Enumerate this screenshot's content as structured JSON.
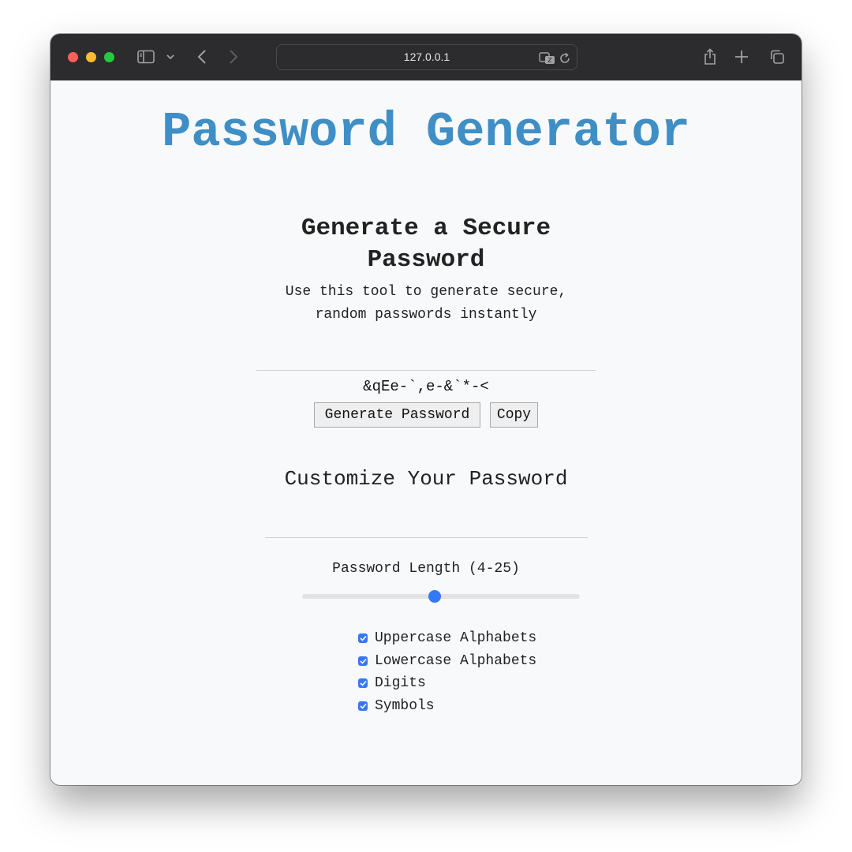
{
  "browser": {
    "url": "127.0.0.1",
    "icons": [
      "sidebar-icon",
      "chevron-down-icon",
      "back-icon",
      "forward-icon",
      "translate-icon",
      "reload-icon",
      "share-icon",
      "new-tab-icon",
      "tabs-overview-icon"
    ]
  },
  "page": {
    "title": "Password Generator",
    "subtitle": "Generate a Secure Password",
    "description": "Use this tool to generate secure, random passwords instantly",
    "password": "&qEe-`,e-&`*-<",
    "buttons": {
      "generate": "Generate Password",
      "copy": "Copy"
    },
    "customize_title": "Customize Your Password",
    "length_label": "Password Length (4-25)",
    "length_slider": {
      "min": 4,
      "max": 25,
      "value": 14
    },
    "options": [
      {
        "label": "Uppercase Alphabets",
        "checked": true
      },
      {
        "label": "Lowercase Alphabets",
        "checked": true
      },
      {
        "label": "Digits",
        "checked": true
      },
      {
        "label": "Symbols",
        "checked": true
      }
    ]
  },
  "colors": {
    "title": "#3f8fc6",
    "accent": "#3478f6",
    "titlebar": "#2c2c2e",
    "background": "#f8f9fb"
  }
}
